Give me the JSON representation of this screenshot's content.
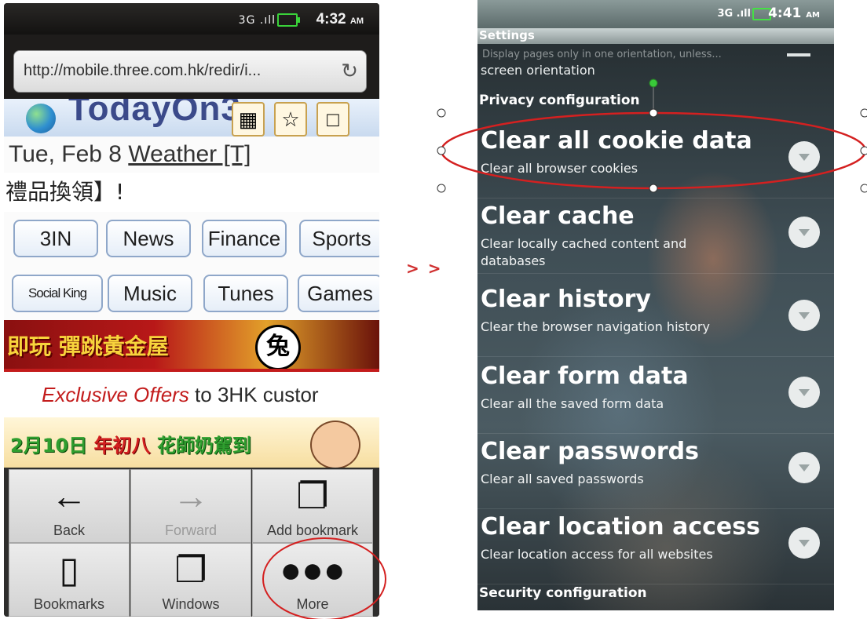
{
  "left_phone": {
    "status": {
      "signal": "3G .ıll",
      "time": "4:32",
      "ampm": "AM"
    },
    "url_bar": {
      "url": "http://mobile.three.com.hk/redir/i...",
      "refresh_icon": "refresh-icon"
    },
    "page": {
      "brand_title": "TodayOn3",
      "date": "Tue, Feb 8",
      "weather_link": "Weather [T]",
      "gift_text": "禮品換領】!",
      "nav_row1": [
        "3IN",
        "News",
        "Finance",
        "Sports"
      ],
      "nav_row2": [
        "Social King",
        "Music",
        "Tunes",
        "Games"
      ],
      "banner1_text": "即玩 彈跳黃金屋",
      "banner1_badge": "兔",
      "offers_emph": "Exclusive Offers",
      "offers_rest": " to 3HK custor",
      "banner2_text_a": "2月10日",
      "banner2_text_b": "年初八",
      "banner2_text_c": "花師奶駕到"
    },
    "menu": {
      "back": "Back",
      "forward": "Forward",
      "add_bookmark": "Add bookmark",
      "bookmarks": "Bookmarks",
      "windows": "Windows",
      "more": "More"
    }
  },
  "arrow_text": "> >",
  "right_phone": {
    "status": {
      "signal": "3G .ıll",
      "time": "4:41",
      "ampm": "AM"
    },
    "header": "Settings",
    "cut_text": "Display pages only in one orientation, unless...",
    "screen_orientation": "screen orientation",
    "privacy_section": "Privacy configuration",
    "items": [
      {
        "title": "Clear all cookie data",
        "subtitle": "Clear all browser cookies"
      },
      {
        "title": "Clear cache",
        "subtitle": "Clear locally cached content and databases"
      },
      {
        "title": "Clear history",
        "subtitle": "Clear the browser navigation history"
      },
      {
        "title": "Clear form data",
        "subtitle": "Clear all the saved form data"
      },
      {
        "title": "Clear passwords",
        "subtitle": "Clear all saved passwords"
      },
      {
        "title": "Clear location access",
        "subtitle": "Clear location access for all websites"
      }
    ],
    "security_section": "Security configuration"
  },
  "colors": {
    "annotation_red": "#d42020",
    "handle_green": "#39c939",
    "offers_red": "#c31c1c",
    "battery_green": "#3ad23a"
  }
}
